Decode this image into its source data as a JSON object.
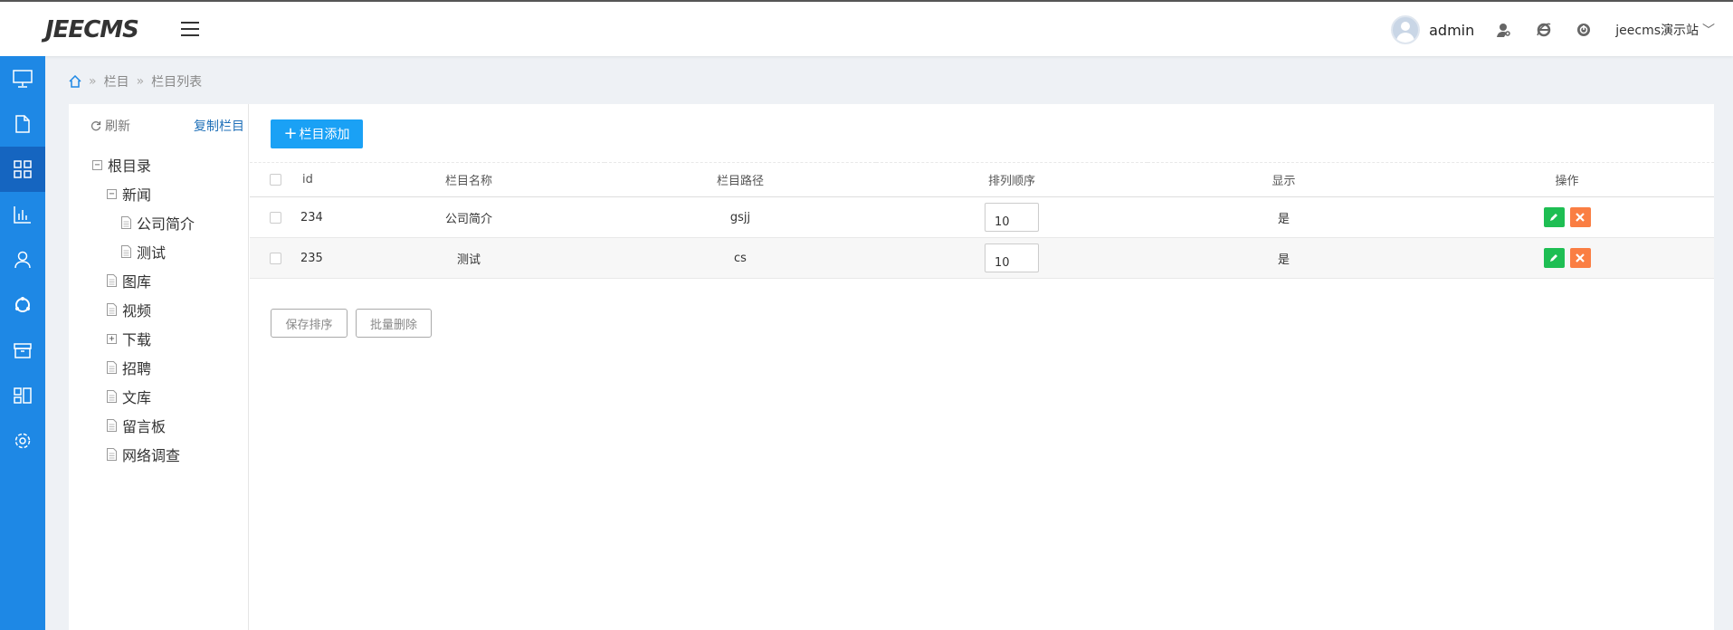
{
  "header": {
    "logo": "JEECMS",
    "username": "admin",
    "site_name": "jeecms演示站",
    "icons": [
      "menu-icon",
      "user-key-icon",
      "ie-icon",
      "power-icon",
      "chevron-down-icon"
    ]
  },
  "sidebar": {
    "items": [
      {
        "icon": "monitor-icon"
      },
      {
        "icon": "document-icon"
      },
      {
        "icon": "grid-icon",
        "active": true
      },
      {
        "icon": "bar-chart-icon"
      },
      {
        "icon": "user-icon"
      },
      {
        "icon": "refresh-circle-icon"
      },
      {
        "icon": "box-icon"
      },
      {
        "icon": "apps-icon"
      },
      {
        "icon": "gear-icon"
      }
    ]
  },
  "breadcrumb": {
    "home_icon": "home-icon",
    "items": [
      "栏目",
      "栏目列表"
    ],
    "sep": "»"
  },
  "tree": {
    "refresh_label": "刷新",
    "copy_label": "复制栏目",
    "nodes": [
      {
        "label": "根目录",
        "toggle": "−"
      },
      {
        "label": "新闻",
        "toggle": "−"
      },
      {
        "label": "公司简介"
      },
      {
        "label": "测试"
      },
      {
        "label": "图库"
      },
      {
        "label": "视频"
      },
      {
        "label": "下载",
        "toggle": "+"
      },
      {
        "label": "招聘"
      },
      {
        "label": "文库"
      },
      {
        "label": "留言板"
      },
      {
        "label": "网络调查"
      }
    ]
  },
  "toolbar": {
    "add_label": "栏目添加"
  },
  "table": {
    "headers": [
      "id",
      "栏目名称",
      "栏目路径",
      "排列顺序",
      "显示",
      "操作"
    ],
    "rows": [
      {
        "id": "234",
        "name": "公司简介",
        "path": "gsjj",
        "order": "10",
        "show": "是"
      },
      {
        "id": "235",
        "name": "测试",
        "path": "cs",
        "order": "10",
        "show": "是"
      }
    ]
  },
  "bottom": {
    "save_order_label": "保存排序",
    "batch_delete_label": "批量删除"
  },
  "colors": {
    "sidebar": "#1e88e5",
    "sidebar_active": "#1565c0",
    "primary": "#1aa1f5",
    "edit": "#1ebe53",
    "delete": "#fa7e43"
  }
}
